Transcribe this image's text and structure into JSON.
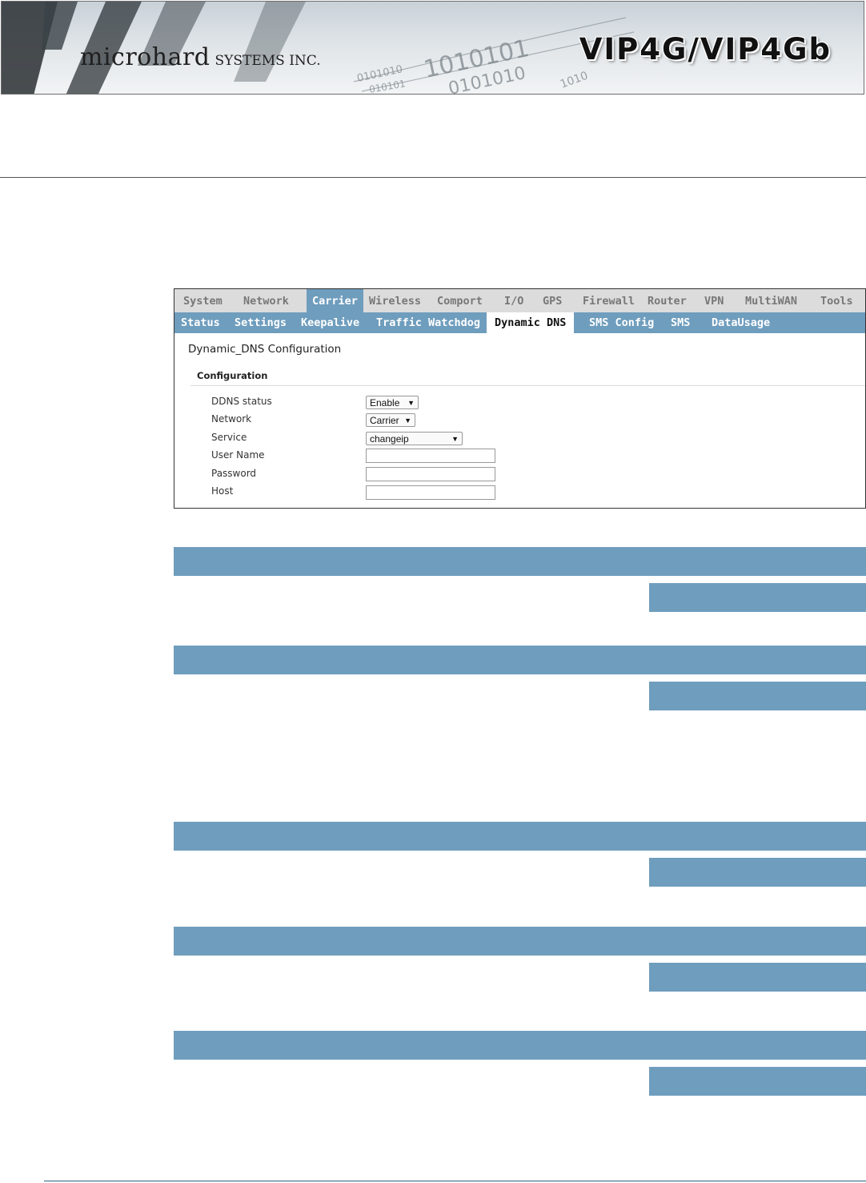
{
  "header": {
    "brand_main": "microhard",
    "brand_sub": "SYSTEMS INC.",
    "product": "VIP4G/VIP4Gb"
  },
  "ui": {
    "main_tabs": [
      "System",
      "Network",
      "Carrier",
      "Wireless",
      "Comport",
      "I/O",
      "GPS",
      "Firewall",
      "Router",
      "VPN",
      "MultiWAN",
      "Tools"
    ],
    "main_active": "Carrier",
    "sub_tabs": [
      "Status",
      "Settings",
      "Keepalive",
      "Traffic Watchdog",
      "Dynamic DNS",
      "SMS Config",
      "SMS",
      "DataUsage"
    ],
    "sub_active": "Dynamic DNS",
    "page_title": "Dynamic_DNS Configuration",
    "section_title": "Configuration",
    "fields": {
      "ddns_status": {
        "label": "DDNS status",
        "value": "Enable"
      },
      "network": {
        "label": "Network",
        "value": "Carrier"
      },
      "service": {
        "label": "Service",
        "value": "changeip"
      },
      "user_name": {
        "label": "User Name",
        "value": ""
      },
      "password": {
        "label": "Password",
        "value": ""
      },
      "host": {
        "label": "Host",
        "value": ""
      }
    }
  },
  "colors": {
    "accent": "#6f9dbd",
    "tab_inactive": "#dcdcdc",
    "rule": "#2e5f7e"
  }
}
